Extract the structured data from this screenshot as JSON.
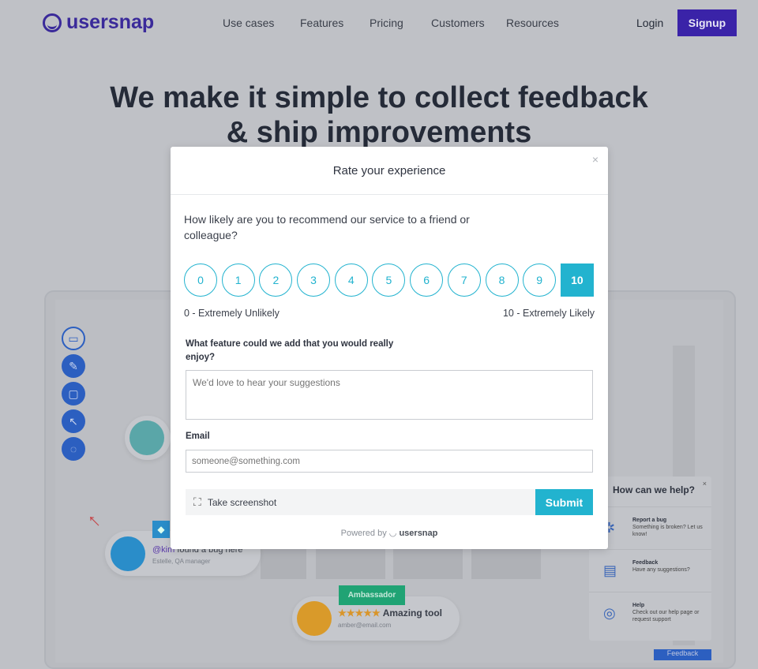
{
  "nav": {
    "logo": "usersnap",
    "items": [
      "Use cases",
      "Features",
      "Pricing",
      "Customers",
      "Resources"
    ],
    "login": "Login",
    "signup": "Signup"
  },
  "hero": {
    "line1": "We make it simple to collect feedback",
    "line2": "& ship improvements"
  },
  "background": {
    "bug_card": {
      "text": "found a bug here",
      "mention": "@kim",
      "role": "Estelle, QA manager"
    },
    "review_card": {
      "badge": "Ambassador",
      "stars": "★★★★★",
      "text": "Amazing tool",
      "email": "amber@email.com"
    },
    "help_widget": {
      "title": "How can we help?",
      "items": [
        {
          "title": "Report a bug",
          "desc": "Something is broken? Let us know!"
        },
        {
          "title": "Feedback",
          "desc": "Have any suggestions?"
        },
        {
          "title": "Help",
          "desc": "Check out our help page or request support"
        }
      ],
      "button": "Feedback"
    }
  },
  "modal": {
    "title": "Rate your experience",
    "question": "How likely are you to recommend our service to a friend or colleague?",
    "scale": [
      "0",
      "1",
      "2",
      "3",
      "4",
      "5",
      "6",
      "7",
      "8",
      "9",
      "10"
    ],
    "selected": "10",
    "low_label": "0 - Extremely Unlikely",
    "high_label": "10 - Extremely Likely",
    "feature_label": "What feature could we add that you would really enjoy?",
    "feature_placeholder": "We'd love to hear your suggestions",
    "email_label": "Email",
    "email_placeholder": "someone@something.com",
    "screenshot_label": "Take screenshot",
    "submit": "Submit",
    "powered_by": "Powered by",
    "brand": "usersnap",
    "accent": "#22b3cf"
  }
}
